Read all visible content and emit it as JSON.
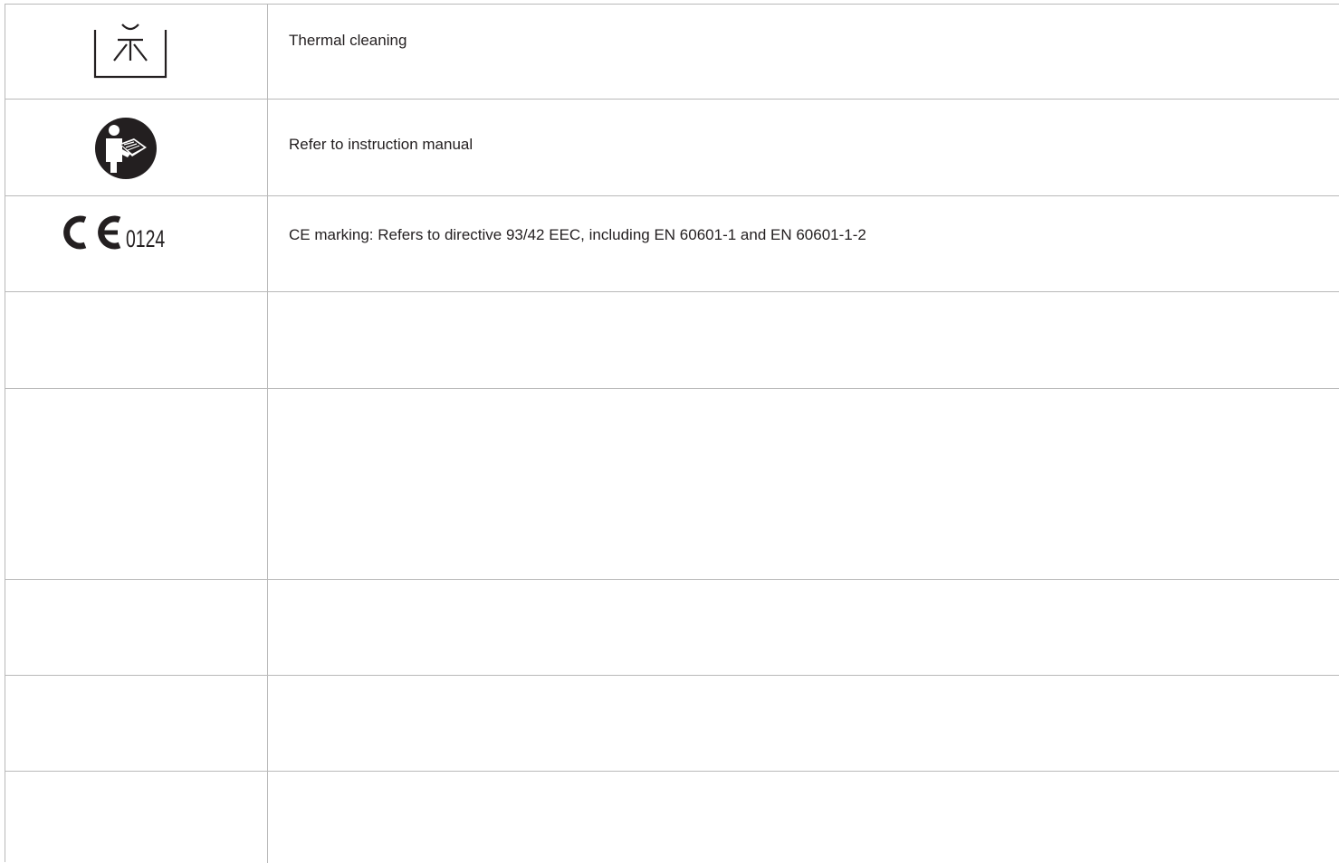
{
  "rows": [
    {
      "symbol": "thermal-cleaning-icon",
      "description": "Thermal cleaning"
    },
    {
      "symbol": "instruction-manual-icon",
      "description": "Refer to instruction manual"
    },
    {
      "symbol": "ce-mark-icon",
      "symbol_text": "0124",
      "description": "CE marking: Refers to directive 93/42 EEC, including EN 60601-1 and EN 60601-1-2"
    },
    {
      "symbol": "",
      "description": ""
    },
    {
      "symbol": "",
      "description": ""
    },
    {
      "symbol": "",
      "description": ""
    },
    {
      "symbol": "",
      "description": ""
    },
    {
      "symbol": "",
      "description": ""
    }
  ],
  "colors": {
    "border": "#b9b9b9",
    "text": "#231f20",
    "icon": "#231f20"
  }
}
